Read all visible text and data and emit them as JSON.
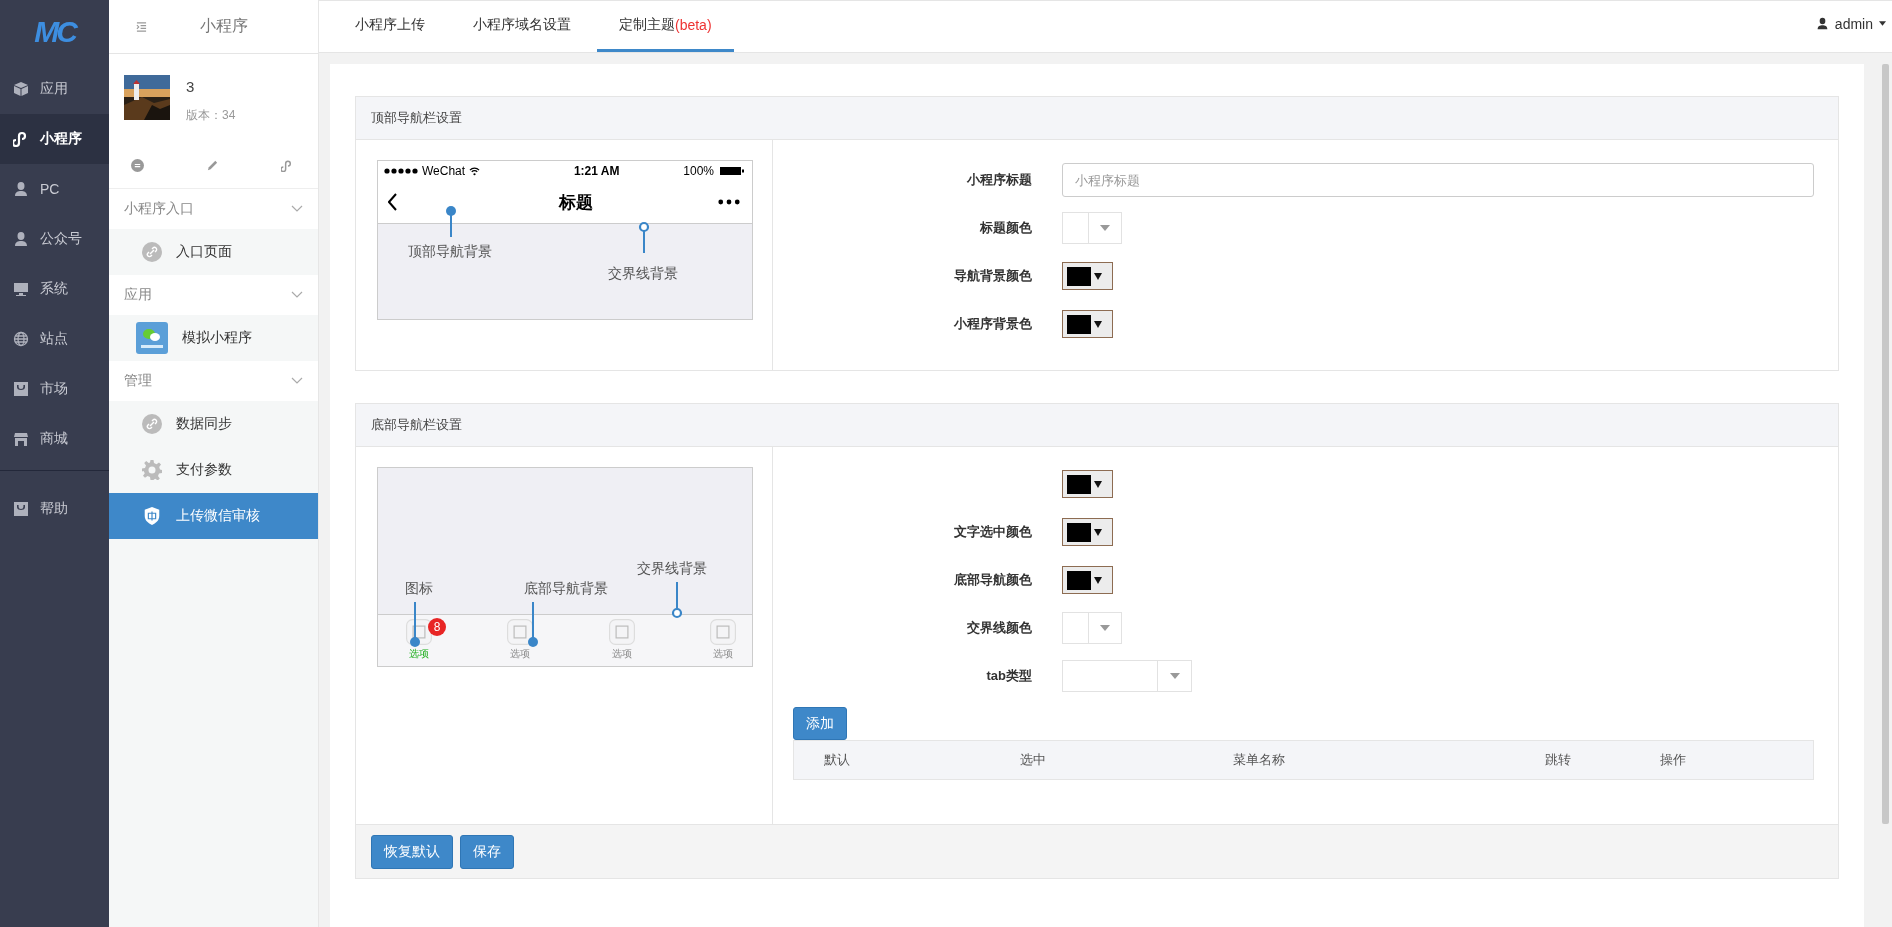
{
  "logo": "MC",
  "main_nav": [
    {
      "label": "应用",
      "kind": "cube",
      "selected": false
    },
    {
      "label": "小程序",
      "kind": "link",
      "selected": true
    },
    {
      "label": "PC",
      "kind": "user",
      "selected": false
    },
    {
      "label": "公众号",
      "kind": "user",
      "selected": false
    },
    {
      "label": "系统",
      "kind": "monitor",
      "selected": false
    },
    {
      "label": "站点",
      "kind": "globe",
      "selected": false
    },
    {
      "label": "市场",
      "kind": "bag",
      "selected": false
    },
    {
      "label": "商城",
      "kind": "store",
      "selected": false
    }
  ],
  "help_nav": [
    {
      "label": "帮助",
      "kind": "bag",
      "selected": false
    }
  ],
  "sub_sidebar": {
    "title": "小程序",
    "app": {
      "name": "3",
      "version": "版本：34"
    },
    "groups": [
      {
        "title": "小程序入口",
        "expanded": true,
        "items": [
          {
            "label": "入口页面",
            "kind": "link",
            "selected": false
          }
        ]
      },
      {
        "title": "应用",
        "expanded": true,
        "items": [
          {
            "label": "模拟小程序",
            "kind": "app",
            "selected": false
          }
        ]
      },
      {
        "title": "管理",
        "expanded": true,
        "items": [
          {
            "label": "数据同步",
            "kind": "link",
            "selected": false
          },
          {
            "label": "支付参数",
            "kind": "gear",
            "selected": false
          },
          {
            "label": "上传微信审核",
            "kind": "shield",
            "selected": true
          }
        ]
      }
    ]
  },
  "tabs": [
    {
      "label": "小程序上传",
      "selected": false
    },
    {
      "label": "小程序域名设置",
      "selected": false
    },
    {
      "label": "定制主题",
      "tag": "(beta)",
      "selected": true
    }
  ],
  "user": "admin",
  "top_section": {
    "title": "顶部导航栏设置",
    "phone": {
      "carrier": "WeChat",
      "time": "1:21 AM",
      "battery": "100%",
      "nav_title": "标题",
      "callouts": [
        "顶部导航背景",
        "交界线背景"
      ]
    },
    "fields": [
      {
        "label": "小程序标题",
        "kind": "input",
        "placeholder": "小程序标题"
      },
      {
        "label": "标题颜色",
        "kind": "picker"
      },
      {
        "label": "导航背景颜色",
        "kind": "swatch"
      },
      {
        "label": "小程序背景色",
        "kind": "swatch"
      }
    ]
  },
  "bottom_section": {
    "title": "底部导航栏设置",
    "phone": {
      "callouts": [
        "图标",
        "底部导航背景",
        "交界线背景"
      ],
      "tabbar": [
        {
          "label": "选项",
          "selected": true,
          "badge": "8"
        },
        {
          "label": "选项",
          "selected": false
        },
        {
          "label": "选项",
          "selected": false
        },
        {
          "label": "选项",
          "selected": false
        }
      ]
    },
    "fields": [
      {
        "kind": "swatch"
      },
      {
        "label": "文字选中颜色",
        "kind": "swatch"
      },
      {
        "label": "底部导航颜色",
        "kind": "swatch"
      },
      {
        "label": "交界线颜色",
        "kind": "picker"
      },
      {
        "label": "tab类型",
        "kind": "select"
      }
    ],
    "add_button": "添加",
    "table": {
      "columns": [
        "默认",
        "选中",
        "菜单名称",
        "跳转",
        "操作"
      ]
    }
  },
  "footer_buttons": [
    "恢复默认",
    "保存"
  ]
}
